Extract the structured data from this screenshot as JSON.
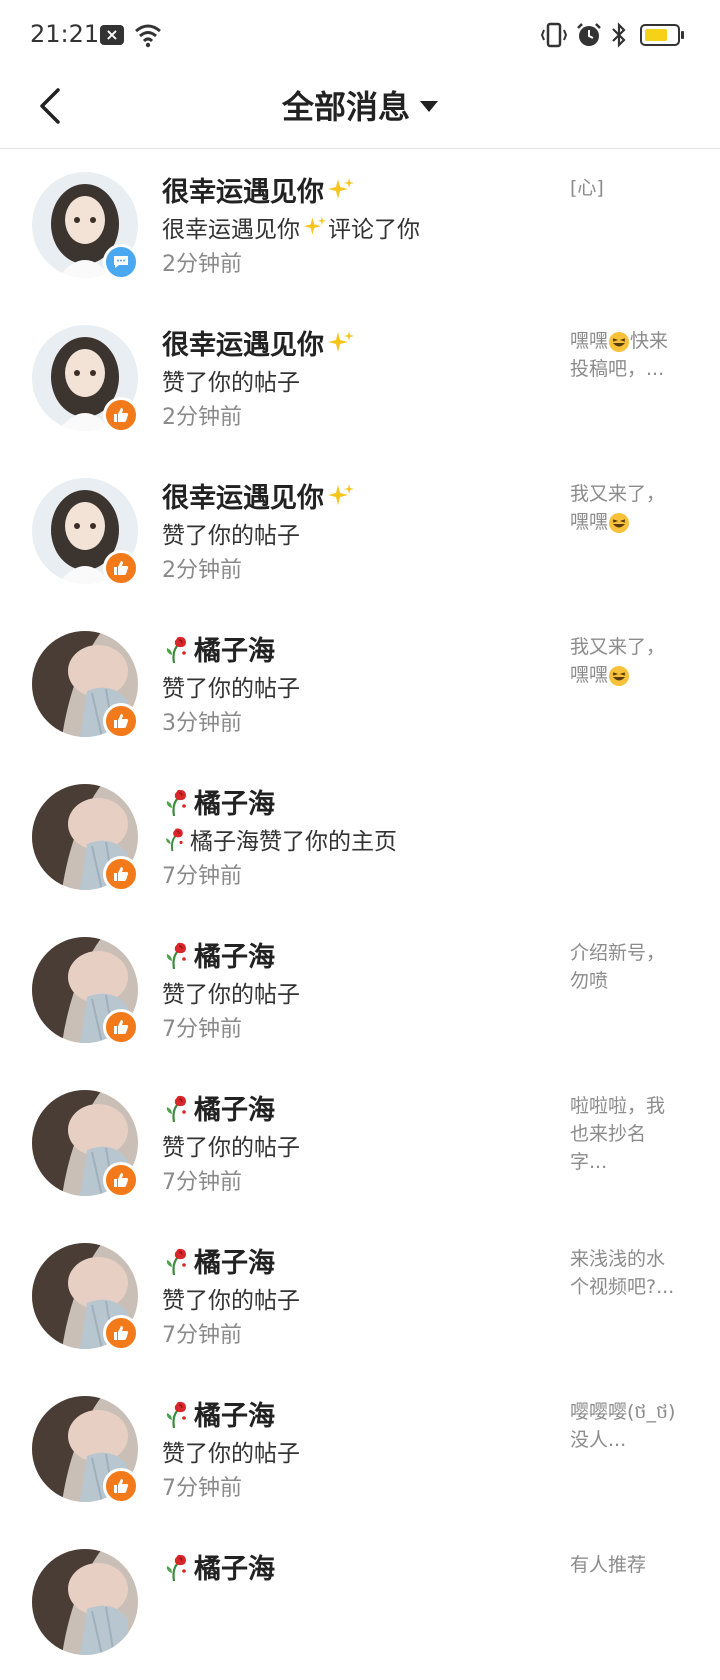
{
  "status_bar": {
    "time": "21:21",
    "notification_icon": "close-box-icon",
    "battery_color": "#f5d218"
  },
  "header": {
    "title": "全部消息",
    "back_icon": "chevron-left-icon",
    "filter_icon": "caret-down-icon"
  },
  "colors": {
    "like_badge": "#f27a1a",
    "comment_badge": "#4aa8f0",
    "sparkle": "#f6c51b",
    "muted": "#8a8a8a"
  },
  "messages": [
    {
      "name": "很幸运遇见你",
      "action": "很幸运遇见你",
      "action_suffix": "评论了你",
      "time": "2分钟前",
      "preview": "[心]",
      "preview_tail": "",
      "badge": "comment"
    },
    {
      "name": "很幸运遇见你",
      "action": "赞了你的帖子",
      "time": "2分钟前",
      "preview": "嘿嘿",
      "preview_tail": "快来投稿吧，...",
      "badge": "like"
    },
    {
      "name": "很幸运遇见你",
      "action": "赞了你的帖子",
      "time": "2分钟前",
      "preview": "我又来了，嘿嘿",
      "preview_tail": "",
      "badge": "like"
    },
    {
      "name": "橘子海",
      "action": "赞了你的帖子",
      "time": "3分钟前",
      "preview": "我又来了，嘿嘿",
      "preview_tail": "",
      "badge": "like"
    },
    {
      "name": "橘子海",
      "action": "橘子海赞了你的主页",
      "time": "7分钟前",
      "preview": "",
      "preview_tail": "",
      "badge": "like"
    },
    {
      "name": "橘子海",
      "action": "赞了你的帖子",
      "time": "7分钟前",
      "preview": "介绍新号，勿喷",
      "preview_tail": "",
      "badge": "like"
    },
    {
      "name": "橘子海",
      "action": "赞了你的帖子",
      "time": "7分钟前",
      "preview": "啦啦啦，我也来抄名字...",
      "preview_tail": "",
      "badge": "like"
    },
    {
      "name": "橘子海",
      "action": "赞了你的帖子",
      "time": "7分钟前",
      "preview": "来浅浅的水个视频吧?...",
      "preview_tail": "",
      "badge": "like"
    },
    {
      "name": "橘子海",
      "action": "赞了你的帖子",
      "time": "7分钟前",
      "preview": "嘤嘤嘤(ថ_ថ)没人...",
      "preview_tail": "",
      "badge": "like"
    },
    {
      "name": "橘子海",
      "action": "",
      "time": "",
      "preview": "有人推荐",
      "preview_tail": "",
      "badge": "like"
    }
  ]
}
